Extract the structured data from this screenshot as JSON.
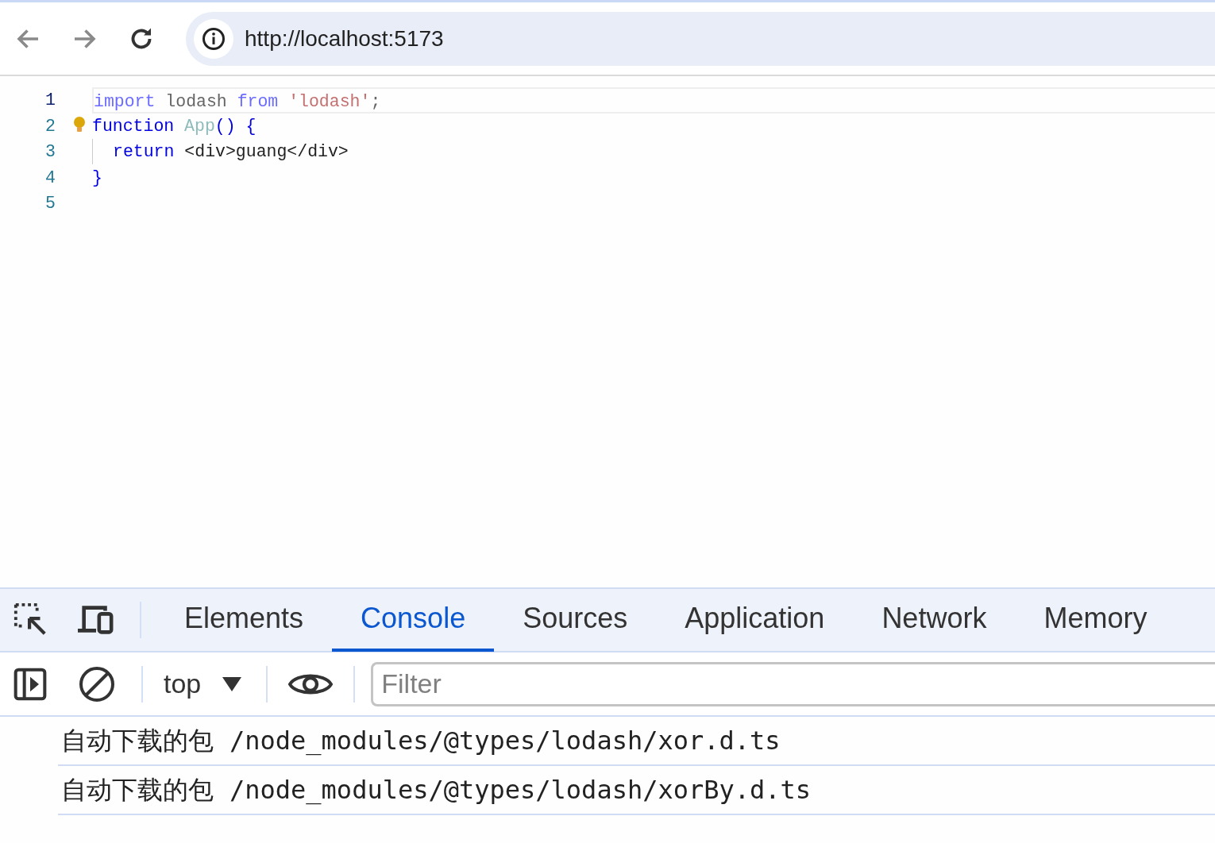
{
  "browser": {
    "url": "http://localhost:5173"
  },
  "editor": {
    "lines": [
      {
        "number": "1",
        "current": true,
        "lightbulb": false,
        "indent": false,
        "tokens": [
          {
            "kind": "keyword",
            "text": "import"
          },
          {
            "kind": "plain",
            "text": " lodash "
          },
          {
            "kind": "keyword",
            "text": "from"
          },
          {
            "kind": "string",
            "text": " 'lodash'"
          },
          {
            "kind": "plain",
            "text": ";"
          }
        ]
      },
      {
        "number": "2",
        "current": false,
        "lightbulb": true,
        "indent": false,
        "tokens": [
          {
            "kind": "control",
            "text": "function"
          },
          {
            "kind": "func",
            "text": " App"
          },
          {
            "kind": "control",
            "text": "() {"
          }
        ]
      },
      {
        "number": "3",
        "current": false,
        "lightbulb": false,
        "indent": true,
        "tokens": [
          {
            "kind": "control",
            "text": "return"
          },
          {
            "kind": "plain",
            "text": " <div>guang</div>"
          }
        ]
      },
      {
        "number": "4",
        "current": false,
        "lightbulb": false,
        "indent": false,
        "tokens": [
          {
            "kind": "control",
            "text": "}"
          }
        ]
      },
      {
        "number": "5",
        "current": false,
        "lightbulb": false,
        "indent": false
      }
    ]
  },
  "devtools": {
    "tabs": [
      {
        "label": "Elements",
        "selected": false
      },
      {
        "label": "Console",
        "selected": true
      },
      {
        "label": "Sources",
        "selected": false
      },
      {
        "label": "Application",
        "selected": false
      },
      {
        "label": "Network",
        "selected": false
      },
      {
        "label": "Memory",
        "selected": false
      }
    ],
    "context": "top",
    "filter": {
      "placeholder": "Filter"
    },
    "messages": [
      {
        "label": "自动下载的包",
        "path": "/node_modules/@types/lodash/xor.d.ts"
      },
      {
        "label": "自动下载的包",
        "path": "/node_modules/@types/lodash/xorBy.d.ts"
      }
    ]
  }
}
